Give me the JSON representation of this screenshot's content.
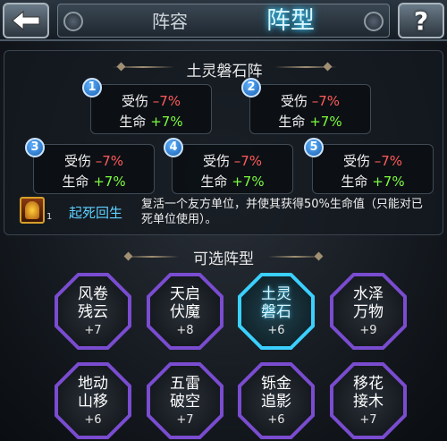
{
  "header": {
    "tab_lineup": "阵容",
    "tab_formation": "阵型",
    "help_label": "?"
  },
  "formation": {
    "name": "土灵磐石阵",
    "slots": [
      {
        "num": "1",
        "dmg_label": "受伤",
        "dmg_value": "–7%",
        "hp_label": "生命",
        "hp_value": "+7%"
      },
      {
        "num": "2",
        "dmg_label": "受伤",
        "dmg_value": "–7%",
        "hp_label": "生命",
        "hp_value": "+7%"
      },
      {
        "num": "3",
        "dmg_label": "受伤",
        "dmg_value": "–7%",
        "hp_label": "生命",
        "hp_value": "+7%"
      },
      {
        "num": "4",
        "dmg_label": "受伤",
        "dmg_value": "–7%",
        "hp_label": "生命",
        "hp_value": "+7%"
      },
      {
        "num": "5",
        "dmg_label": "受伤",
        "dmg_value": "–7%",
        "hp_label": "生命",
        "hp_value": "+7%"
      }
    ],
    "skill": {
      "icon": "revive-skill-icon",
      "level": "1",
      "name": "起死回生",
      "desc": "复活一个友方单位，并使其获得50%生命值（只能对已死单位使用）。"
    }
  },
  "available": {
    "title": "可选阵型",
    "items": [
      {
        "l1": "风卷",
        "l2": "残云",
        "level": "+7",
        "selected": false
      },
      {
        "l1": "天启",
        "l2": "伏魔",
        "level": "+8",
        "selected": false
      },
      {
        "l1": "土灵",
        "l2": "磐石",
        "level": "+6",
        "selected": true
      },
      {
        "l1": "水泽",
        "l2": "万物",
        "level": "+9",
        "selected": false
      },
      {
        "l1": "地动",
        "l2": "山移",
        "level": "+6",
        "selected": false
      },
      {
        "l1": "五雷",
        "l2": "破空",
        "level": "+7",
        "selected": false
      },
      {
        "l1": "铄金",
        "l2": "追影",
        "level": "+6",
        "selected": false
      },
      {
        "l1": "移花",
        "l2": "接木",
        "level": "+7",
        "selected": false
      }
    ]
  },
  "colors": {
    "accent_cyan": "#3bd0ff",
    "octagon_purple": "#7a4cd0",
    "debuff_red": "#ff5a5a",
    "buff_green": "#7dfc3f"
  }
}
